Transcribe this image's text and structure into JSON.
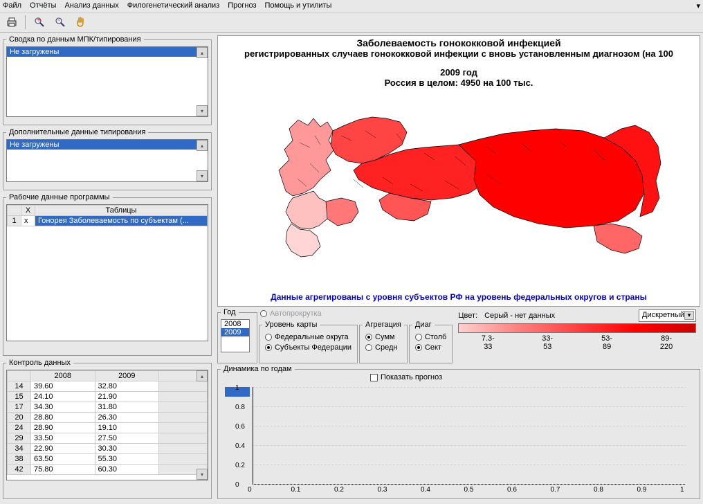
{
  "menu": {
    "file": "Файл",
    "reports": "Отчёты",
    "analysis": "Анализ данных",
    "phylo": "Филогенетический анализ",
    "forecast": "Прогноз",
    "help": "Помощь и утилиты"
  },
  "panels": {
    "svodka_title": "Сводка по данным МПК/типирования",
    "svodka_item": "Не загружены",
    "dop_title": "Дополнительные данные типирования",
    "dop_item": "Не загружены",
    "rabochie_title": "Рабочие данные программы",
    "tbl_col_x": "X",
    "tbl_col_tables": "Таблицы",
    "rabochie_row": "Гонорея Заболеваемость по субъектам (...",
    "kontrol_title": "Контроль данных"
  },
  "kontrol": {
    "col1": "2008",
    "col2": "2009",
    "rows": [
      {
        "h": "14",
        "a": "39.60",
        "b": "32.80"
      },
      {
        "h": "15",
        "a": "24.10",
        "b": "21.90"
      },
      {
        "h": "17",
        "a": "34.30",
        "b": "31.80"
      },
      {
        "h": "20",
        "a": "28.80",
        "b": "26.30"
      },
      {
        "h": "24",
        "a": "28.90",
        "b": "19.10"
      },
      {
        "h": "29",
        "a": "33.50",
        "b": "27.50"
      },
      {
        "h": "34",
        "a": "22.90",
        "b": "30.30"
      },
      {
        "h": "38",
        "a": "63.50",
        "b": "55.30"
      },
      {
        "h": "42",
        "a": "75.80",
        "b": "60.30"
      }
    ]
  },
  "map": {
    "title": "Заболеваемость гонококковой инфекцией",
    "subtitle": "регистрированных случаев гонококковой инфекции с вновь установленным диагнозом (на 100",
    "year": "2009 год",
    "total": "Россия в целом: 4950 на 100 тыс.",
    "note": "Данные агрегированы с уровня субъектов РФ на уровень федеральных округов и страны"
  },
  "controls": {
    "year_label": "Год",
    "autoscroll": "Автопрокрутка",
    "years": [
      "2008",
      "2009"
    ],
    "year_selected": "2009",
    "maplevel_label": "Уровень карты",
    "maplevel1": "Федеральные округа",
    "maplevel2": "Субъекты Федерации",
    "agg_label": "Агрегация",
    "agg1": "Сумм",
    "agg2": "Средн",
    "diag_label": "Диаг",
    "diag1": "Столб",
    "diag2": "Сект",
    "color_label": "Цвет:",
    "color_note": "Серый - нет данных",
    "color_mode": "Дискретный",
    "legend": [
      "7.3-\n33",
      "33-\n53",
      "53-\n89",
      "89-\n220"
    ]
  },
  "dynamics": {
    "title": "Динамика по годам",
    "show_forecast": "Показать прогноз",
    "yticks": [
      "0",
      "0.2",
      "0.4",
      "0.6",
      "0.8",
      "1"
    ],
    "xticks": [
      "0",
      "0.1",
      "0.2",
      "0.3",
      "0.4",
      "0.5",
      "0.6",
      "0.7",
      "0.8",
      "0.9",
      "1"
    ]
  },
  "chart_data": {
    "type": "map",
    "title": "Заболеваемость гонококковой инфекцией (2009)",
    "metric": "регистрированные случаи на 100 тыс.",
    "country_total": 4950,
    "legend_bins": [
      {
        "min": 7.3,
        "max": 33
      },
      {
        "min": 33,
        "max": 53
      },
      {
        "min": 53,
        "max": 89
      },
      {
        "min": 89,
        "max": 220
      }
    ]
  }
}
